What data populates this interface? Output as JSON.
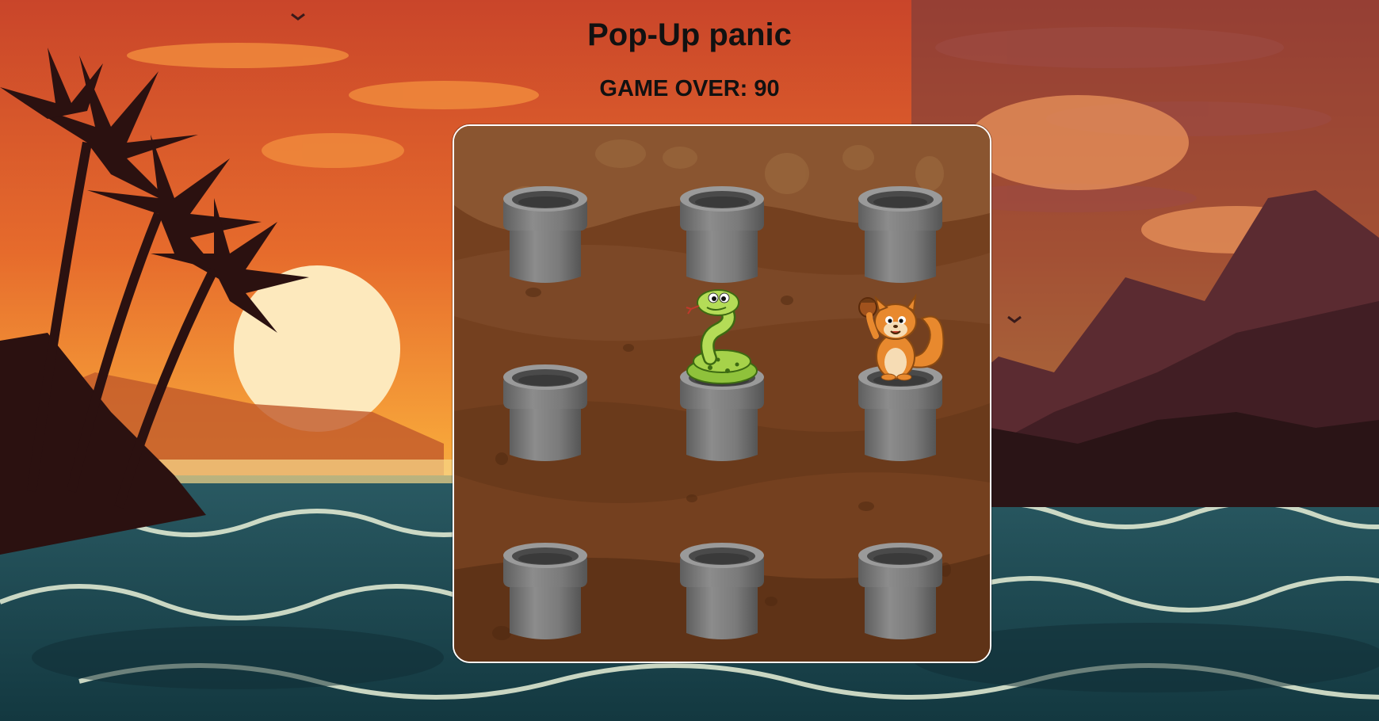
{
  "header": {
    "title": "Pop-Up panic",
    "status": "GAME OVER: 90"
  },
  "board": {
    "rows": 3,
    "cols": 3,
    "holes": [
      {
        "row": 1,
        "col": 1,
        "occupant": "empty"
      },
      {
        "row": 1,
        "col": 2,
        "occupant": "empty"
      },
      {
        "row": 1,
        "col": 3,
        "occupant": "empty"
      },
      {
        "row": 2,
        "col": 1,
        "occupant": "empty"
      },
      {
        "row": 2,
        "col": 2,
        "occupant": "snake"
      },
      {
        "row": 2,
        "col": 3,
        "occupant": "squirrel"
      },
      {
        "row": 3,
        "col": 1,
        "occupant": "empty"
      },
      {
        "row": 3,
        "col": 2,
        "occupant": "empty"
      },
      {
        "row": 3,
        "col": 3,
        "occupant": "empty"
      }
    ]
  },
  "icons": {
    "hole": "gray-pipe-icon",
    "snake": "green-snake-icon",
    "squirrel": "orange-squirrel-with-acorn-icon"
  },
  "colors": {
    "board_dirt": "#74401f",
    "board_border": "#ffffff",
    "pipe": "#7f7f7f",
    "title_text": "#111111"
  }
}
